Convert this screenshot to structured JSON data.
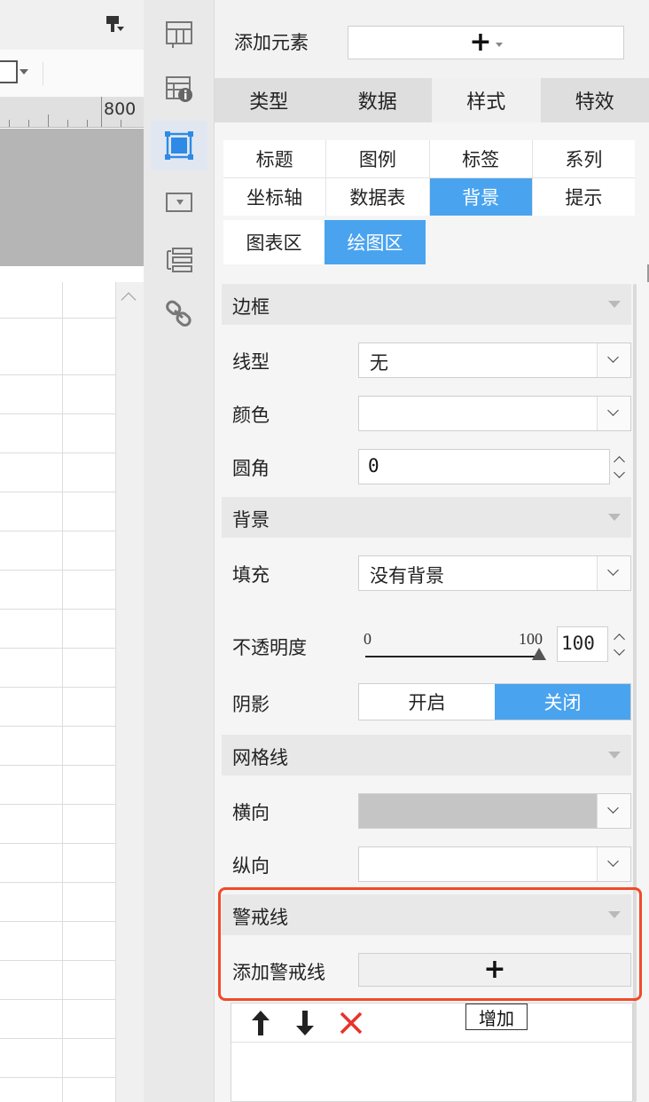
{
  "left": {
    "ruler_label": "800"
  },
  "strip": {
    "icons": [
      "layout-icon",
      "table-info-icon",
      "chart-area-icon",
      "dropdown-icon",
      "list-icon",
      "link-icon"
    ],
    "active_index": 2,
    "accent_color": "#4aa3ee"
  },
  "panel": {
    "add_element_label": "添加元素",
    "add_element_button": "+",
    "main_tabs": [
      {
        "label": "类型",
        "active": false
      },
      {
        "label": "数据",
        "active": false
      },
      {
        "label": "样式",
        "active": true
      },
      {
        "label": "特效",
        "active": false
      }
    ],
    "sub_tabs": [
      {
        "label": "标题",
        "active": false
      },
      {
        "label": "图例",
        "active": false
      },
      {
        "label": "标签",
        "active": false
      },
      {
        "label": "系列",
        "active": false
      },
      {
        "label": "坐标轴",
        "active": false
      },
      {
        "label": "数据表",
        "active": false
      },
      {
        "label": "背景",
        "active": true
      },
      {
        "label": "提示",
        "active": false
      }
    ],
    "area_tabs": [
      {
        "label": "图表区",
        "active": false
      },
      {
        "label": "绘图区",
        "active": true
      }
    ]
  },
  "border_section": {
    "title": "边框",
    "line_type_label": "线型",
    "line_type_value": "无",
    "color_label": "颜色",
    "radius_label": "圆角",
    "radius_value": "0"
  },
  "background_section": {
    "title": "背景",
    "fill_label": "填充",
    "fill_value": "没有背景",
    "opacity_label": "不透明度",
    "opacity_min": "0",
    "opacity_max": "100",
    "opacity_value": "100",
    "opacity_fraction": 1.0,
    "shadow_label": "阴影",
    "shadow_on": "开启",
    "shadow_off": "关闭",
    "shadow_active": "off"
  },
  "gridline_section": {
    "title": "网格线",
    "horizontal_label": "横向",
    "horizontal_color": "#c5c5c5",
    "vertical_label": "纵向"
  },
  "warning_section": {
    "title": "警戒线",
    "add_label": "添加警戒线",
    "add_button": "+",
    "highlight_color": "#f04a2a",
    "list_add_button": "增加"
  }
}
